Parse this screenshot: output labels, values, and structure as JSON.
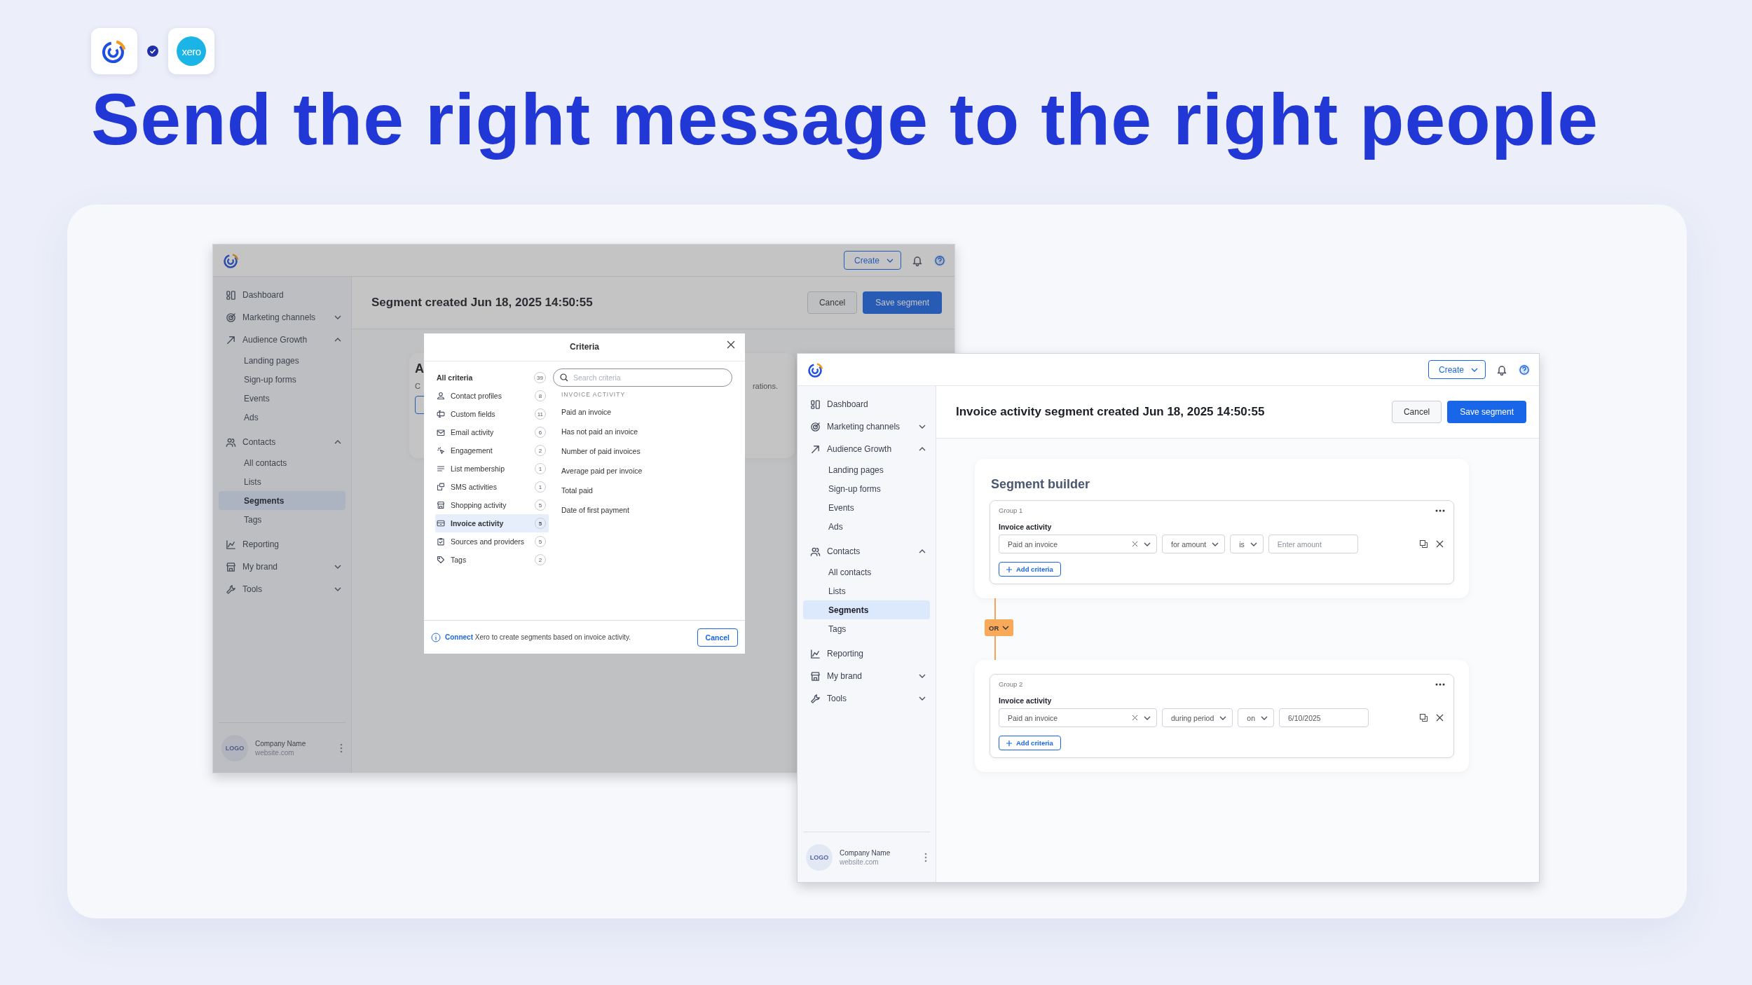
{
  "logos": {
    "partner_text": "xero",
    "connected": true
  },
  "headline": "Send the right message to the right people",
  "windows": [
    {
      "dimmed": true,
      "create": "Create",
      "sidebar": {
        "items": [
          {
            "label": "Dashboard"
          },
          {
            "label": "Marketing channels",
            "expanded": false
          },
          {
            "label": "Audience Growth",
            "expanded": true,
            "children": [
              {
                "label": "Landing pages",
                "selected": false
              },
              {
                "label": "Sign-up forms",
                "selected": false
              },
              {
                "label": "Events",
                "selected": false
              },
              {
                "label": "Ads",
                "selected": false
              }
            ]
          },
          {
            "label": "Contacts",
            "expanded": true,
            "children": [
              {
                "label": "All contacts",
                "selected": false
              },
              {
                "label": "Lists",
                "selected": false
              },
              {
                "label": "Segments",
                "selected": true
              },
              {
                "label": "Tags",
                "selected": false
              }
            ]
          },
          {
            "label": "Reporting"
          },
          {
            "label": "My brand",
            "expanded": false
          },
          {
            "label": "Tools",
            "expanded": false
          }
        ],
        "footer": {
          "avatar": "LOGO",
          "company": "Company Name",
          "website": "website.com"
        }
      },
      "header": {
        "title": "Segment created Jun 18, 2025 14:50:55",
        "cancel": "Cancel",
        "save": "Save segment"
      },
      "background_card": {
        "heading": "A",
        "text_start": "C",
        "text_end": "rations."
      },
      "modal": {
        "title": "Criteria",
        "all_criteria": {
          "label": "All criteria",
          "count": "39"
        },
        "categories": [
          {
            "label": "Contact profiles",
            "count": "8",
            "selected": false
          },
          {
            "label": "Custom fields",
            "count": "11",
            "selected": false
          },
          {
            "label": "Email activity",
            "count": "6",
            "selected": false
          },
          {
            "label": "Engagement",
            "count": "2",
            "selected": false
          },
          {
            "label": "List membership",
            "count": "1",
            "selected": false
          },
          {
            "label": "SMS activities",
            "count": "1",
            "selected": false
          },
          {
            "label": "Shopping activity",
            "count": "5",
            "selected": false
          },
          {
            "label": "Invoice activity",
            "count": "5",
            "selected": true
          },
          {
            "label": "Sources and providers",
            "count": "5",
            "selected": false
          },
          {
            "label": "Tags",
            "count": "2",
            "selected": false
          }
        ],
        "search_placeholder": "Search criteria",
        "section": "INVOICE ACTIVITY",
        "options": [
          "Paid an invoice",
          "Has not paid an invoice",
          "Number of paid invoices",
          "Average paid per invoice",
          "Total paid",
          "Date of first payment"
        ],
        "notice": {
          "link": "Connect",
          "text": " Xero to create segments based on invoice activity."
        },
        "cancel": "Cancel"
      }
    },
    {
      "dimmed": false,
      "create": "Create",
      "sidebar": {
        "items": [
          {
            "label": "Dashboard"
          },
          {
            "label": "Marketing channels",
            "expanded": false
          },
          {
            "label": "Audience Growth",
            "expanded": true,
            "children": [
              {
                "label": "Landing pages",
                "selected": false
              },
              {
                "label": "Sign-up forms",
                "selected": false
              },
              {
                "label": "Events",
                "selected": false
              },
              {
                "label": "Ads",
                "selected": false
              }
            ]
          },
          {
            "label": "Contacts",
            "expanded": true,
            "children": [
              {
                "label": "All contacts",
                "selected": false
              },
              {
                "label": "Lists",
                "selected": false
              },
              {
                "label": "Segments",
                "selected": true
              },
              {
                "label": "Tags",
                "selected": false
              }
            ]
          },
          {
            "label": "Reporting"
          },
          {
            "label": "My brand",
            "expanded": false
          },
          {
            "label": "Tools",
            "expanded": false
          }
        ],
        "footer": {
          "avatar": "LOGO",
          "company": "Company Name",
          "website": "website.com"
        }
      },
      "header": {
        "title": "Invoice activity segment created Jun 18, 2025 14:50:55",
        "cancel": "Cancel",
        "save": "Save segment"
      },
      "builder": {
        "title": "Segment builder",
        "connector": "OR",
        "groups": [
          {
            "label": "Group 1",
            "title": "Invoice activity",
            "add": "Add criteria",
            "fields": [
              {
                "kind": "clearable",
                "value": "Paid an invoice"
              },
              {
                "kind": "select",
                "value": "for amount"
              },
              {
                "kind": "select",
                "value": "is"
              },
              {
                "kind": "input",
                "placeholder": "Enter amount"
              }
            ]
          },
          {
            "label": "Group 2",
            "title": "Invoice activity",
            "add": "Add criteria",
            "fields": [
              {
                "kind": "clearable",
                "value": "Paid an invoice"
              },
              {
                "kind": "select",
                "value": "during period"
              },
              {
                "kind": "select",
                "value": "on"
              },
              {
                "kind": "input",
                "value": "6/10/2025"
              }
            ]
          }
        ]
      }
    }
  ]
}
